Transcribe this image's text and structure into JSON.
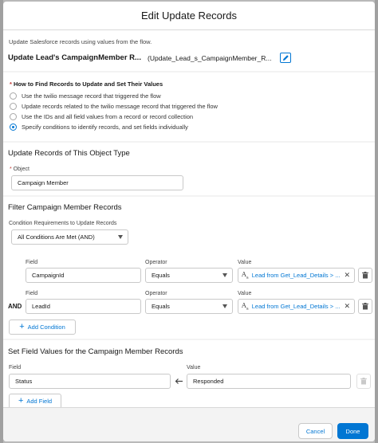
{
  "modal": {
    "title": "Edit Update Records"
  },
  "intro": {
    "description": "Update Salesforce records using values from the flow.",
    "element_label": "Update Lead's CampaignMember R...",
    "api_name": "(Update_Lead_s_CampaignMember_R..."
  },
  "how_to_find": {
    "label": "How to Find Records to Update and Set Their Values",
    "options": [
      "Use the twilio message record that triggered the flow",
      "Update records related to the twilio message record that triggered the flow",
      "Use the IDs and all field values from a record or record collection",
      "Specify conditions to identify records, and set fields individually"
    ],
    "selected_index": 3
  },
  "object_section": {
    "heading": "Update Records of This Object Type",
    "object_label": "Object",
    "object_value": "Campaign Member"
  },
  "filter_section": {
    "heading": "Filter Campaign Member Records",
    "requirement_label": "Condition Requirements to Update Records",
    "requirement_value": "All Conditions Are Met (AND)",
    "col_field": "Field",
    "col_operator": "Operator",
    "col_value": "Value",
    "conditions": [
      {
        "prefix": "",
        "field": "CampaignId",
        "operator": "Equals",
        "value": "Lead from Get_Lead_Details > ..."
      },
      {
        "prefix": "AND",
        "field": "LeadId",
        "operator": "Equals",
        "value": "Lead from Get_Lead_Details > ..."
      }
    ],
    "add_condition_label": "Add Condition"
  },
  "set_fields_section": {
    "heading": "Set Field Values for the Campaign Member Records",
    "col_field": "Field",
    "col_value": "Value",
    "rows": [
      {
        "field": "Status",
        "value": "Responded"
      }
    ],
    "add_field_label": "Add Field"
  },
  "footer": {
    "cancel_label": "Cancel",
    "done_label": "Done"
  },
  "colors": {
    "brand_blue": "#0176d3",
    "required_red": "#c23934",
    "panel_gray": "#f3f3f3"
  },
  "icons": [
    "pencil-icon",
    "trash-icon",
    "arrow-left-icon",
    "clear-icon",
    "text-type-icon",
    "plus-icon",
    "chevron-down-icon"
  ]
}
